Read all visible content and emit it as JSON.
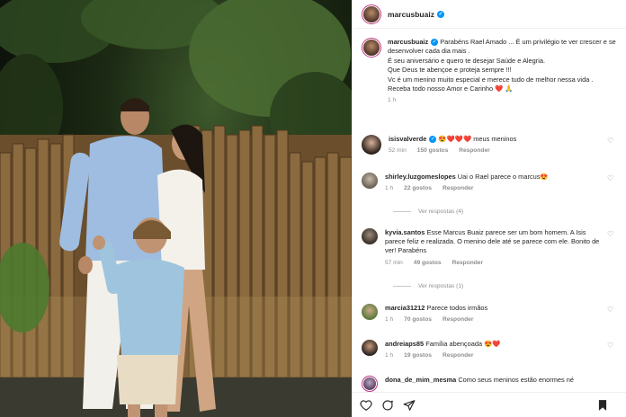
{
  "post": {
    "author": "marcusbuaiz",
    "caption_lines": [
      "Parabéns Rael Amado ... É um privilégio te ver crescer e se desenvolver cada dia mais .",
      "É seu aniversário e quero te desejar Saúde e Alegria.",
      "Que Deus te abençoe e proteja sempre !!!",
      "Vc é um menino muito especial e merece tudo de melhor nessa vida .",
      "Receba todo nosso Amor e Carinho ❤️ 🙏"
    ],
    "time": "1 h"
  },
  "comments": [
    {
      "user": "isisvalverde",
      "text": "😍❤️❤️❤️ meus meninos",
      "time": "52 min",
      "likes": "150 gostos",
      "reply": "Responder",
      "verified": true
    },
    {
      "user": "shirley.luzgomeslopes",
      "text": "Uai o Rael parece o marcus😍",
      "time": "1 h",
      "likes": "22 gostos",
      "reply": "Responder",
      "view_replies": "Ver respostas (4)"
    },
    {
      "user": "kyvia.santos",
      "text": "Esse Marcus Buaiz parece ser um bom homem. A Isis parece feliz e realizada. O menino dele até se parece com ele. Bonito de ver! Parabéns",
      "time": "57 min",
      "likes": "49 gostos",
      "reply": "Responder",
      "view_replies": "Ver respostas (1)"
    },
    {
      "user": "marcia31212",
      "text": "Parece todos irmãos",
      "time": "1 h",
      "likes": "70 gostos",
      "reply": "Responder"
    },
    {
      "user": "andreiaps85",
      "text": "Família abençoada 😍❤️",
      "time": "1 h",
      "likes": "19 gostos",
      "reply": "Responder"
    },
    {
      "user": "dona_de_mim_mesma",
      "text": "Como seus meninos estão enormes né"
    }
  ],
  "colors": {
    "accent": "#0095f6",
    "like": "#ed4956",
    "muted": "#8e8e8e"
  },
  "icons": [
    "heart-icon",
    "comment-icon",
    "share-icon",
    "bookmark-icon",
    "verified-icon"
  ]
}
